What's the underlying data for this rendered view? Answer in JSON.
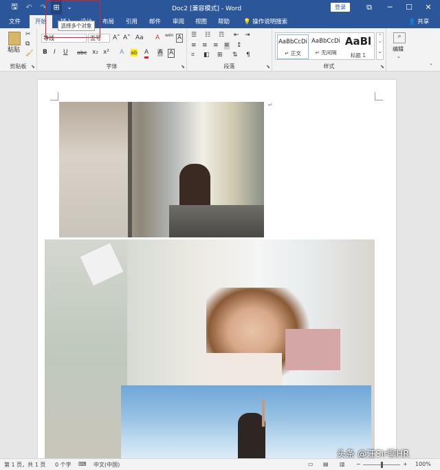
{
  "titlebar": {
    "title": "Doc2 [兼容模式] - Word",
    "login": "登录",
    "quick_access": {
      "save": "🖫",
      "undo": "↶",
      "redo": "↷",
      "select_objects": "⊞",
      "customize": "⌄"
    },
    "window": {
      "ribbon_options": "⧉",
      "minimize": "─",
      "maximize": "☐",
      "close": "✕"
    }
  },
  "tooltip": "选择多个对象",
  "tabs": [
    {
      "label": "文件"
    },
    {
      "label": "开始"
    },
    {
      "label": "插入"
    },
    {
      "label": "设计"
    },
    {
      "label": "布局"
    },
    {
      "label": "引用"
    },
    {
      "label": "邮件"
    },
    {
      "label": "审阅"
    },
    {
      "label": "视图"
    },
    {
      "label": "帮助"
    }
  ],
  "tell_me": "操作说明搜索",
  "share": "共享",
  "ribbon": {
    "clipboard": {
      "label": "剪贴板",
      "paste": "粘贴"
    },
    "font": {
      "label": "字体",
      "font_name": "等线",
      "font_size": "五号",
      "grow": "A˄",
      "shrink": "A˅",
      "case": "Aa",
      "clear": "A",
      "wen": "wén",
      "wen_box": "A",
      "bold": "B",
      "italic": "I",
      "underline": "U",
      "strike": "abc",
      "sub": "x₂",
      "sup": "x²",
      "effects": "A",
      "highlight": "ab",
      "font_color": "A",
      "shading": "A",
      "border_char": "A"
    },
    "paragraph": {
      "label": "段落"
    },
    "styles": {
      "label": "样式",
      "items": [
        {
          "sample": "AaBbCcDi",
          "name": "↵ 正文"
        },
        {
          "sample": "AaBbCcDi",
          "name": "↵ 无间隔"
        },
        {
          "sample": "AaBl",
          "name": "标题 1"
        }
      ]
    },
    "editing": {
      "label": "编辑"
    }
  },
  "document": {
    "paragraph_mark": "↵"
  },
  "status": {
    "page": "第 1 页，共 1 页",
    "words": "0 个字",
    "language": "中文(中国)",
    "zoom": "100%"
  },
  "watermark": "头条 @汪Sir聊HR"
}
